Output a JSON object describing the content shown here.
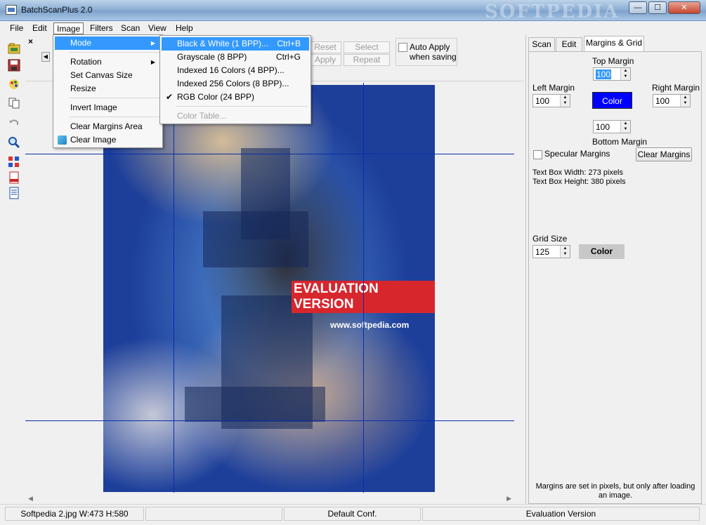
{
  "window": {
    "title": "BatchScanPlus 2.0",
    "watermark": "SOFTPEDIA",
    "min_symbol": "—",
    "max_symbol": "☐",
    "close_symbol": "✕"
  },
  "menubar": [
    "File",
    "Edit",
    "Image",
    "Filters",
    "Scan",
    "View",
    "Help"
  ],
  "image_menu": {
    "items": [
      {
        "label": "Mode",
        "submenu": true,
        "highlighted": true
      },
      {
        "label": "Rotation",
        "submenu": true
      },
      {
        "label": "Set Canvas Size"
      },
      {
        "label": "Resize"
      },
      {
        "label": "Invert Image"
      },
      {
        "label": "Clear Margins Area"
      },
      {
        "label": "Clear Image"
      }
    ]
  },
  "mode_menu": {
    "items": [
      {
        "label": "Black & White (1 BPP)...",
        "shortcut": "Ctrl+B",
        "highlighted": true
      },
      {
        "label": "Grayscale (8 BPP)",
        "shortcut": "Ctrl+G"
      },
      {
        "label": "Indexed 16 Colors (4 BPP)..."
      },
      {
        "label": "Indexed 256 Colors (8 BPP)..."
      },
      {
        "label": "RGB Color (24 BPP)",
        "checked": true
      },
      {
        "label": "Color Table...",
        "disabled": true
      }
    ]
  },
  "toolbar": {
    "reset": "Reset",
    "select": "Select",
    "apply": "Apply",
    "repeat": "Repeat",
    "auto_apply_line1": "Auto Apply",
    "auto_apply_line2": "when saving"
  },
  "canvas": {
    "banner": "EVALUATION VERSION",
    "image_watermark": "www.softpedia.com"
  },
  "right_panel": {
    "tabs": [
      "Scan",
      "Edit",
      "Margins & Grid"
    ],
    "active_tab": "Margins & Grid",
    "top_margin_label": "Top Margin",
    "top_margin_value": "100",
    "left_margin_label": "Left Margin",
    "left_margin_value": "100",
    "right_margin_label": "Right Margin",
    "right_margin_value": "100",
    "bottom_margin_label": "Bottom Margin",
    "bottom_margin_value": "100",
    "margin_color_label": "Color",
    "margin_color": "#0000ff",
    "specular_label": "Specular Margins",
    "clear_margins": "Clear Margins",
    "text_box_width": "Text Box Width: 273 pixels",
    "text_box_height": "Text Box Height: 380 pixels",
    "grid_size_label": "Grid Size",
    "grid_size_value": "125",
    "grid_color_label": "Color",
    "grid_color": "#c8c8c8",
    "note": "Margins are set in pixels, but only after loading an image."
  },
  "statusbar": {
    "file_info": "Softpedia 2.jpg W:473 H:580",
    "config": "Default Conf.",
    "version": "Evaluation Version"
  }
}
